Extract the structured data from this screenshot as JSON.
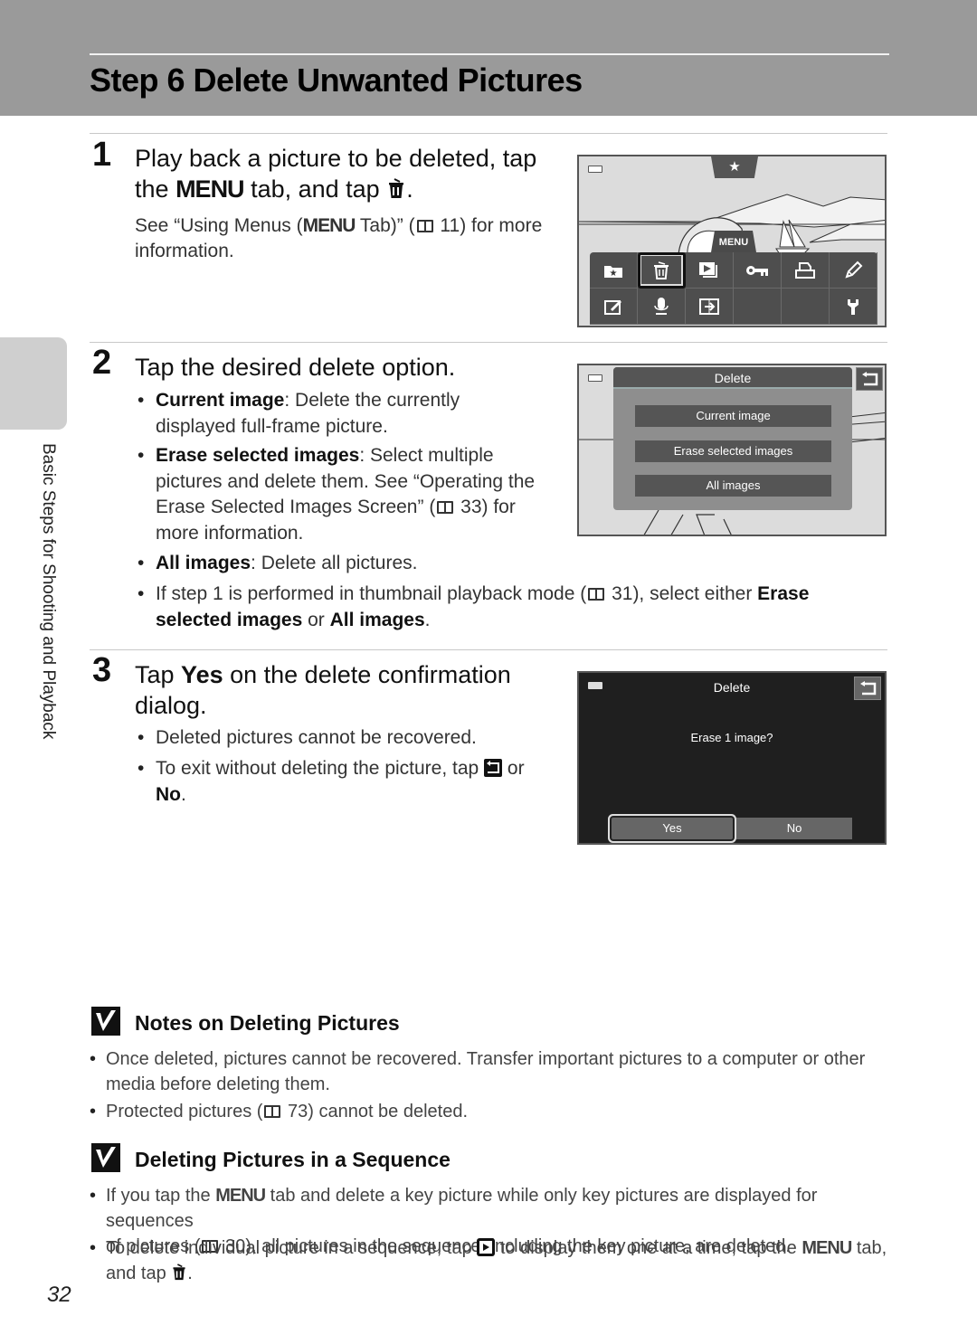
{
  "page": {
    "title": "Step 6 Delete Unwanted Pictures",
    "side_label": "Basic Steps for Shooting and Playback",
    "page_number": "32"
  },
  "glyphs": {
    "menu": "MENU",
    "book": "book-reference-icon",
    "trash": "trash-icon",
    "back": "back-icon",
    "playback": "playback-icon"
  },
  "step1": {
    "number": "1",
    "heading_a": "Play back a picture to be deleted, tap",
    "heading_b_pre": "the",
    "heading_b_mid": "tab, and tap",
    "heading_b_end": ".",
    "desc_pre": "See “Using Menus (",
    "desc_mid": "Tab)” (",
    "desc_ref": "11",
    "desc_post": ") for more",
    "desc_line2": "information.",
    "screen": {
      "top_tab": "★",
      "menu_tab": "MENU",
      "menu_items": [
        "favorite",
        "delete",
        "slide-show",
        "protect",
        "print-order",
        "retouch",
        "voice-memo-edit",
        "voice-memo",
        "copy",
        "",
        "",
        "setup"
      ]
    }
  },
  "step2": {
    "number": "2",
    "heading": "Tap the desired delete option.",
    "bullets": [
      {
        "bold": "Current image",
        "text": ": Delete the currently",
        "line2": "displayed full-frame picture."
      },
      {
        "bold": "Erase selected images",
        "text": ": Select multiple",
        "line2": "pictures and delete them. See “Operating the",
        "line3_pre": "Erase Selected Images Screen” (",
        "line3_ref": "33",
        "line3_post": ") for",
        "line4": "more information."
      },
      {
        "bold": "All images",
        "text": ": Delete all pictures."
      }
    ],
    "note": {
      "pre": "If step 1 is performed in thumbnail playback mode (",
      "ref": "31",
      "mid": "), select either ",
      "bold1": "Erase",
      "bold1b": "selected images",
      "or": " or ",
      "bold2": "All images",
      "end": "."
    },
    "screen": {
      "title": "Delete",
      "options": [
        "Current image",
        "Erase selected images",
        "All images"
      ]
    }
  },
  "step3": {
    "number": "3",
    "heading_pre": "Tap ",
    "heading_bold": "Yes",
    "heading_post": " on the delete confirmation",
    "heading_line2": "dialog.",
    "bullets": [
      {
        "text": "Deleted pictures cannot be recovered."
      },
      {
        "pre": "To exit without deleting the picture, tap ",
        "post": " or",
        "bold": "No",
        "end": "."
      }
    ],
    "screen": {
      "title": "Delete",
      "message": "Erase 1 image?",
      "yes": "Yes",
      "no": "No"
    }
  },
  "notes": [
    {
      "heading": "Notes on Deleting Pictures",
      "bullets": [
        {
          "line1": "Once deleted, pictures cannot be recovered. Transfer important pictures to a computer or other",
          "line2": "media before deleting them."
        },
        {
          "pre": "Protected pictures (",
          "ref": "73",
          "post": ") cannot be deleted."
        }
      ]
    },
    {
      "heading": "Deleting Pictures in a Sequence",
      "bullets": [
        {
          "pre": "If you tap the ",
          "post": " tab and delete a key picture while only key pictures are displayed for sequences",
          "line2_pre": "of pictures (",
          "line2_ref": "30",
          "line2_post": "), all pictures in the sequence, including the key picture, are deleted."
        },
        {
          "pre": "To delete individual picture in a sequence, tap ",
          "mid": " to display them one at a time, tap the ",
          "post": " tab,",
          "line2": "and tap ",
          "end": "."
        }
      ]
    }
  ]
}
